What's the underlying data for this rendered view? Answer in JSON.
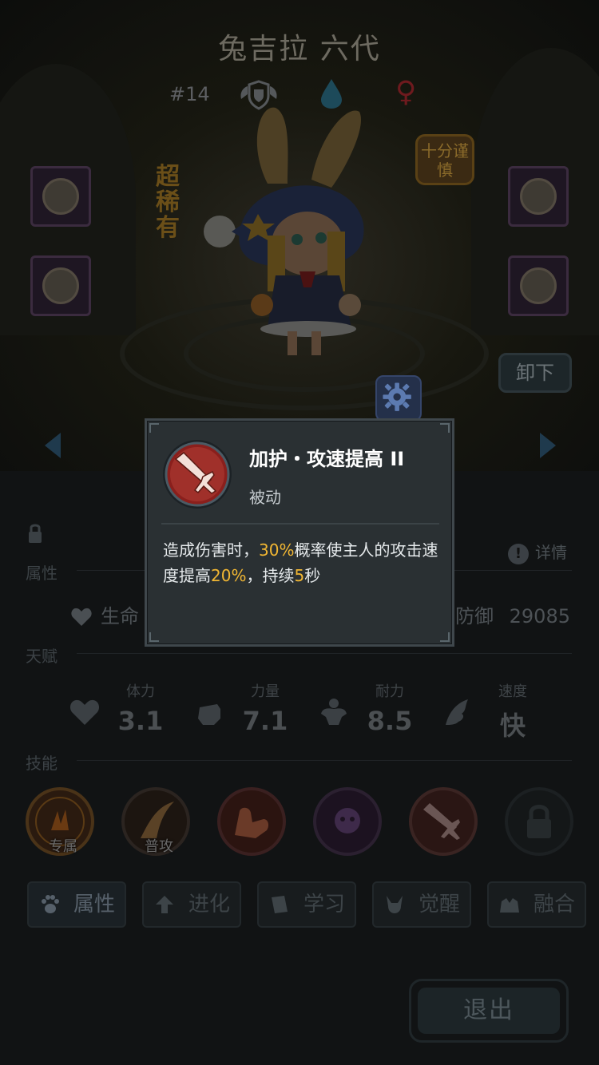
{
  "hero": {
    "name": "兔吉拉 六代",
    "number": "#14",
    "rarity": "超稀有",
    "trait": "十分谨慎"
  },
  "icons": {
    "rank": "winged-shield-icon",
    "element": "water-drop-icon",
    "gender": "♀",
    "settings": "gear-icon"
  },
  "actions": {
    "unequip": "卸下",
    "exit": "退出"
  },
  "sections": {
    "attributes": "属性",
    "talent": "天赋",
    "skills": "技能",
    "detail": "详情"
  },
  "stats": {
    "life_label": "生命",
    "defense_label": "防御",
    "defense_value": "29085"
  },
  "talents": [
    {
      "label": "体力",
      "value": "3.1"
    },
    {
      "label": "力量",
      "value": "7.1"
    },
    {
      "label": "耐力",
      "value": "8.5"
    },
    {
      "label": "速度",
      "value": "快"
    }
  ],
  "skill_tags": {
    "exclusive": "专属",
    "normal": "普攻"
  },
  "tabs": [
    {
      "label": "属性"
    },
    {
      "label": "进化"
    },
    {
      "label": "学习"
    },
    {
      "label": "觉醒"
    },
    {
      "label": "融合"
    }
  ],
  "popup": {
    "title": "加护・攻速提高 II",
    "type": "被动",
    "desc_1": "造成伤害时，",
    "desc_pct1": "30%",
    "desc_2": "概率使主人的攻击速度提高",
    "desc_pct2": "20%",
    "desc_3": "，持续",
    "desc_num": "5",
    "desc_4": "秒"
  },
  "colors": {
    "highlight": "#f2b733",
    "popup_bg": "#2a3033"
  }
}
